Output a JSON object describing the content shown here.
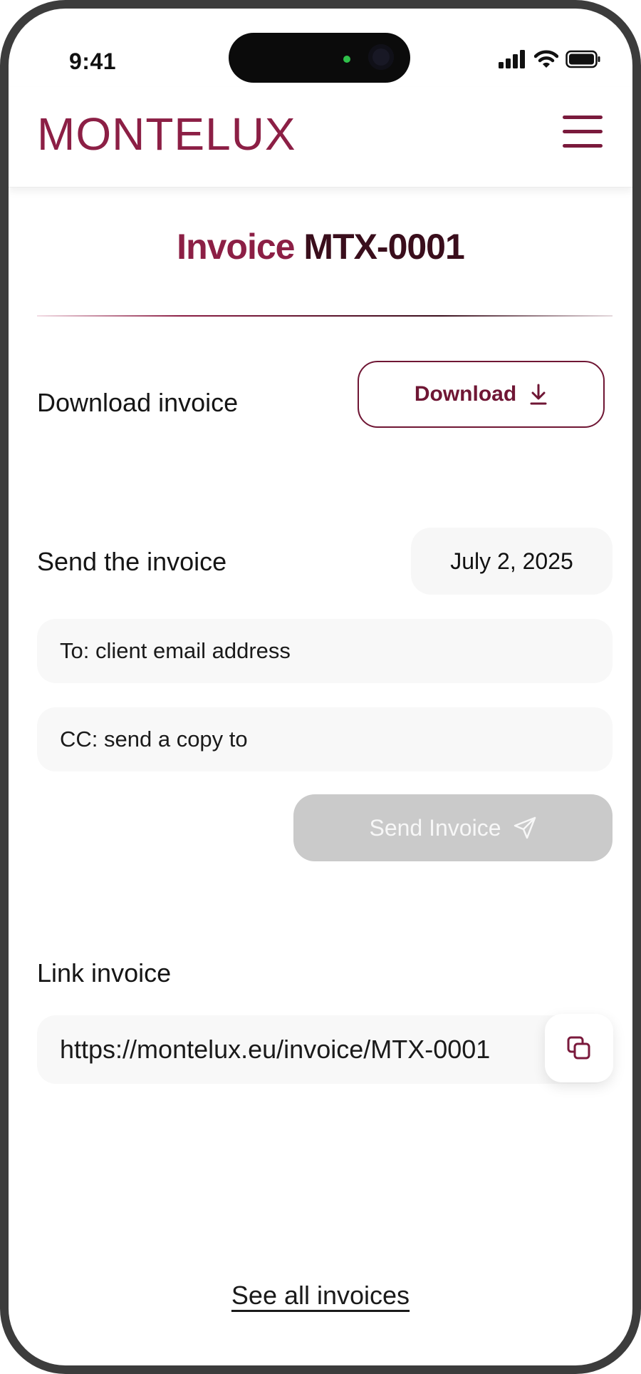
{
  "status_bar": {
    "time": "9:41"
  },
  "header": {
    "logo": "MONTELUX"
  },
  "page": {
    "title_prefix": "Invoice",
    "title_number": "MTX-0001"
  },
  "download": {
    "label": "Download invoice",
    "button_label": "Download"
  },
  "send": {
    "label": "Send the invoice",
    "date": "July 2, 2025",
    "to_placeholder": "To: client email address",
    "cc_placeholder": "CC: send a copy to",
    "button_label": "Send Invoice"
  },
  "link": {
    "label": "Link invoice",
    "url": "https://montelux.eu/invoice/MTX-0001"
  },
  "footer": {
    "see_all_label": "See all invoices"
  },
  "colors": {
    "brand": "#8c1f45",
    "brand_dark": "#3a0e1c",
    "disabled": "#cacaca",
    "field_bg": "#f8f8f8"
  },
  "icons": [
    "signal-icon",
    "wifi-icon",
    "battery-icon",
    "menu-icon",
    "download-icon",
    "send-icon",
    "copy-icon"
  ]
}
